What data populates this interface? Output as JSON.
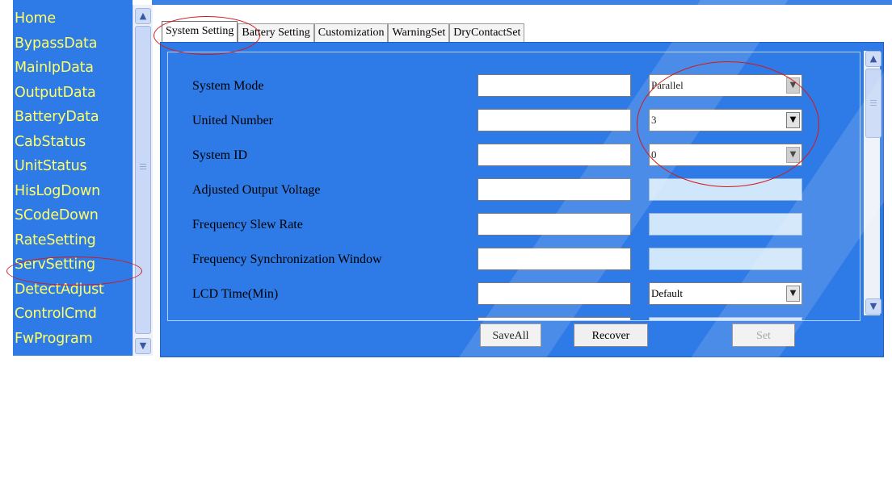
{
  "nav": {
    "items": [
      "Home",
      "BypassData",
      "MainIpData",
      "OutputData",
      "BatteryData",
      "CabStatus",
      "UnitStatus",
      "HisLogDown",
      "SCodeDown",
      "RateSetting",
      "ServSetting",
      "DetectAdjust",
      "ControlCmd",
      "FwProgram"
    ]
  },
  "tabs": [
    "System Setting",
    "Battery Setting",
    "Customization",
    "WarningSet",
    "DryContactSet"
  ],
  "active_tab": "System Setting",
  "form": {
    "rows": [
      {
        "label": "System Mode",
        "input_value": "",
        "select_value": "Parallel",
        "select_enabled": true
      },
      {
        "label": "United Number",
        "input_value": "",
        "select_value": "3",
        "select_enabled": true
      },
      {
        "label": "System ID",
        "input_value": "",
        "select_value": "0",
        "select_enabled": true
      },
      {
        "label": "Adjusted Output Voltage",
        "input_value": "",
        "select_value": "",
        "select_enabled": false
      },
      {
        "label": "Frequency Slew Rate",
        "input_value": "",
        "select_value": "",
        "select_enabled": false
      },
      {
        "label": "Frequency Synchronization Window",
        "input_value": "",
        "select_value": "",
        "select_enabled": false
      },
      {
        "label": "LCD Time(Min)",
        "input_value": "",
        "select_value": "Default",
        "select_enabled": true
      }
    ]
  },
  "buttons": {
    "save_all": "SaveAll",
    "recover": "Recover",
    "set": "Set"
  },
  "colors": {
    "panel_blue": "#2e7ae6",
    "nav_text": "#ffff66",
    "annotation_red": "#d31a1a"
  },
  "icons": {
    "scroll_up": "triangle-up",
    "scroll_down": "triangle-down",
    "dropdown": "triangle-down"
  }
}
